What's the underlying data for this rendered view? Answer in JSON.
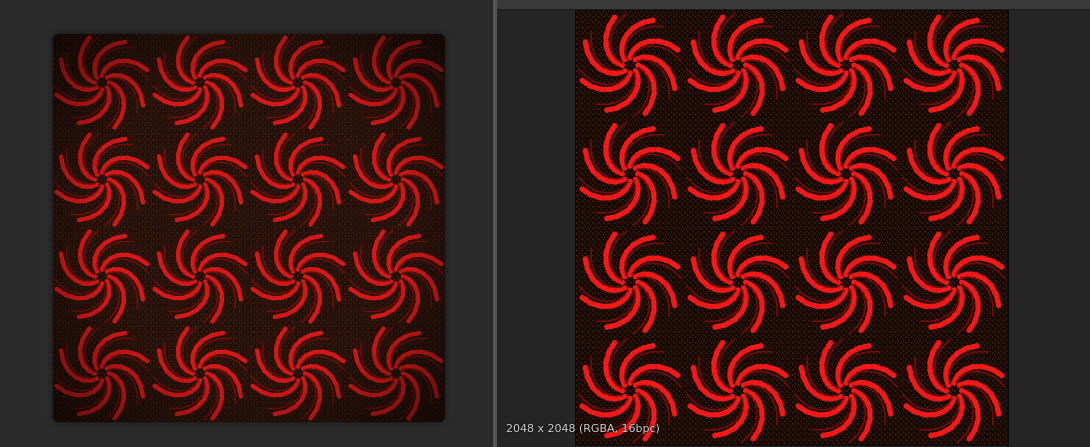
{
  "viewport_3d": {
    "pattern_icon": "pinwheel-swirl-pattern",
    "pattern_grid": {
      "columns": 4,
      "rows": 4
    }
  },
  "viewport_2d": {
    "resolution_label": "2048 x 2048 (RGBA, 16bpc)",
    "pattern_icon": "pinwheel-swirl-pattern",
    "pattern_grid": {
      "columns": 4,
      "rows": 4
    }
  },
  "colors": {
    "pattern_red": "#ff1a1a",
    "pattern_dark_red": "#7a0d0a",
    "background_brown": "#2a1408",
    "texture_black": "#0a0503",
    "panel_bg": "#2b2b2b",
    "splitter": "#555555"
  }
}
